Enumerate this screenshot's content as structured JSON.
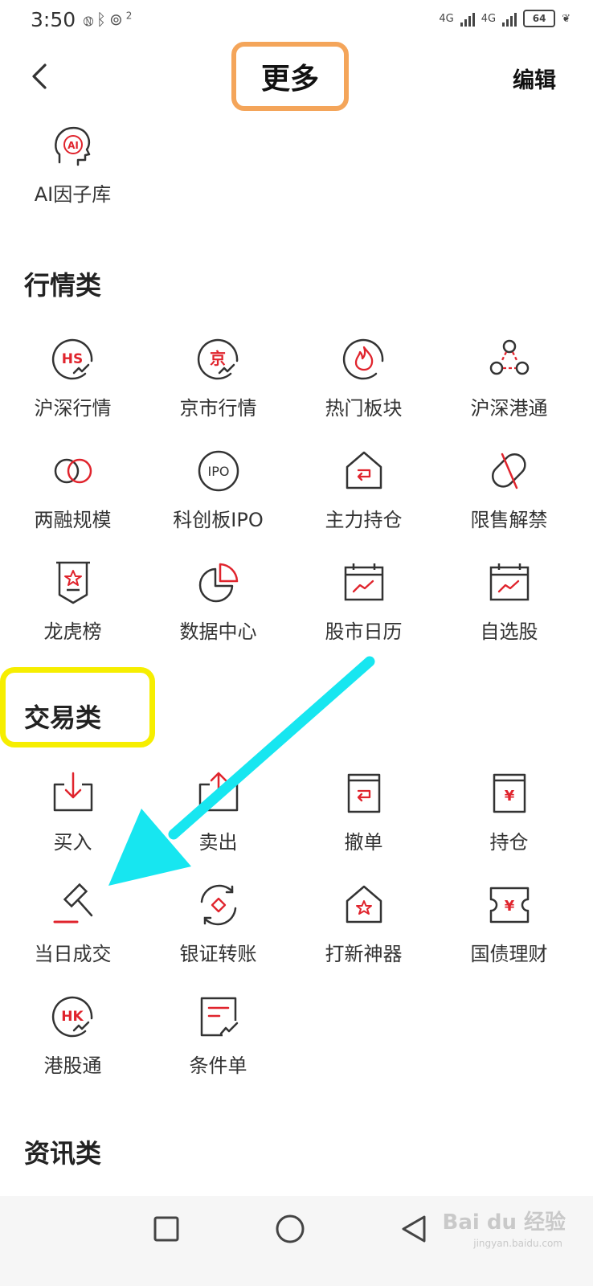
{
  "status_bar": {
    "time": "3:50",
    "network_badge": "2",
    "signal_labels": [
      "4G",
      "4G"
    ],
    "battery": "64"
  },
  "header": {
    "title": "更多",
    "edit_label": "编辑"
  },
  "top_item": {
    "label": "AI因子库",
    "icon": "ai-head-icon"
  },
  "sections": [
    {
      "title": "行情类",
      "items": [
        {
          "label": "沪深行情",
          "icon": "hs-market-icon"
        },
        {
          "label": "京市行情",
          "icon": "jing-market-icon"
        },
        {
          "label": "热门板块",
          "icon": "hot-sector-icon"
        },
        {
          "label": "沪深港通",
          "icon": "connect-icon"
        },
        {
          "label": "两融规模",
          "icon": "margin-icon"
        },
        {
          "label": "科创板IPO",
          "icon": "ipo-icon"
        },
        {
          "label": "主力持仓",
          "icon": "main-position-icon"
        },
        {
          "label": "限售解禁",
          "icon": "lockup-icon"
        },
        {
          "label": "龙虎榜",
          "icon": "dragon-tiger-icon"
        },
        {
          "label": "数据中心",
          "icon": "data-center-icon"
        },
        {
          "label": "股市日历",
          "icon": "calendar-icon"
        },
        {
          "label": "自选股",
          "icon": "watchlist-icon"
        }
      ]
    },
    {
      "title": "交易类",
      "items": [
        {
          "label": "买入",
          "icon": "buy-icon"
        },
        {
          "label": "卖出",
          "icon": "sell-icon"
        },
        {
          "label": "撤单",
          "icon": "cancel-order-icon"
        },
        {
          "label": "持仓",
          "icon": "holdings-icon"
        },
        {
          "label": "当日成交",
          "icon": "gavel-icon"
        },
        {
          "label": "银证转账",
          "icon": "transfer-icon"
        },
        {
          "label": "打新神器",
          "icon": "ipo-subscribe-icon"
        },
        {
          "label": "国债理财",
          "icon": "treasury-icon"
        },
        {
          "label": "港股通",
          "icon": "hk-connect-icon"
        },
        {
          "label": "条件单",
          "icon": "conditional-order-icon"
        }
      ]
    },
    {
      "title": "资讯类",
      "items": []
    }
  ],
  "icon_glyphs": {
    "hs": "HS",
    "jing": "京",
    "ipo": "IPO",
    "hk": "HK",
    "ai": "AI",
    "yen": "¥"
  },
  "colors": {
    "accent_red": "#e0242d",
    "icon_dark": "#333333",
    "title_highlight": "#f4a55a",
    "section_highlight": "#f6ee00",
    "arrow": "#17e6f0"
  },
  "watermark": {
    "brand": "Bai du 经验",
    "url": "jingyan.baidu.com"
  }
}
